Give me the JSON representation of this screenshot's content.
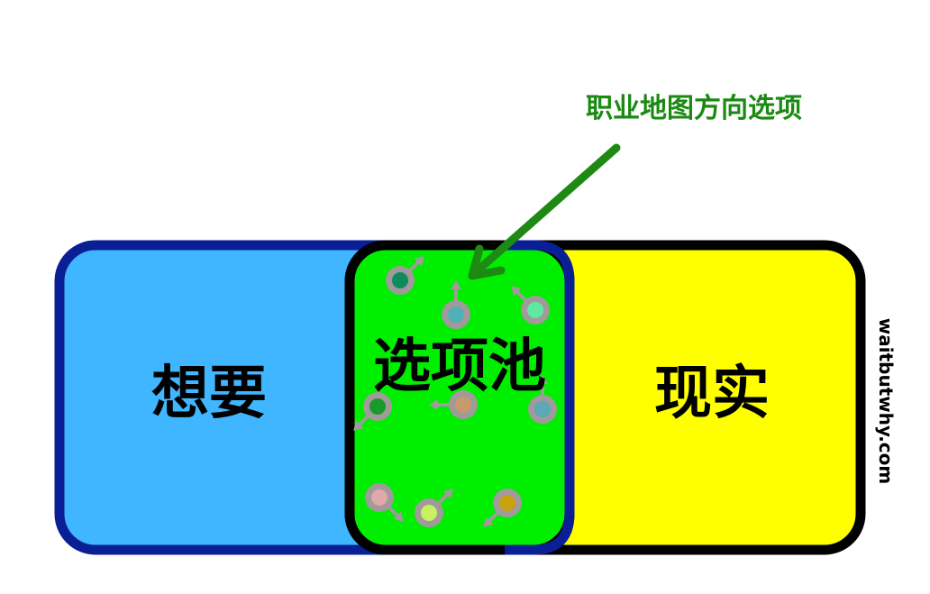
{
  "labels": {
    "want": "想要",
    "pool": "选项池",
    "reality": "现实",
    "callout": "职业地图方向选项",
    "watermark": "waitbutwhy.com"
  },
  "colors": {
    "want_fill": "#3fb6ff",
    "want_border": "#0a1e96",
    "reality_fill": "#ffff00",
    "reality_border": "#000000",
    "pool_fill": "#00ee00",
    "pool_border_left": "#000000",
    "pool_border_right": "#0a1e96",
    "callout_text": "#1a8a12",
    "arrow": "#1e8a14",
    "marker_ring": "#a09a9a"
  },
  "option_markers": [
    {
      "name": "option-marker-1",
      "color": "#0f8a5f",
      "direction": "up-right"
    },
    {
      "name": "option-marker-2",
      "color": "#4fb0b8",
      "direction": "up"
    },
    {
      "name": "option-marker-3",
      "color": "#60e8a0",
      "direction": "up-left"
    },
    {
      "name": "option-marker-4",
      "color": "#1a9a2a",
      "direction": "down-left"
    },
    {
      "name": "option-marker-5",
      "color": "#c89a6a",
      "direction": "left"
    },
    {
      "name": "option-marker-6",
      "color": "#5aa8b8",
      "direction": "up"
    },
    {
      "name": "option-marker-7",
      "color": "#e0a8a8",
      "direction": "down-right"
    },
    {
      "name": "option-marker-8",
      "color": "#c8f060",
      "direction": "up-right"
    },
    {
      "name": "option-marker-9",
      "color": "#c8a010",
      "direction": "down-left"
    }
  ]
}
